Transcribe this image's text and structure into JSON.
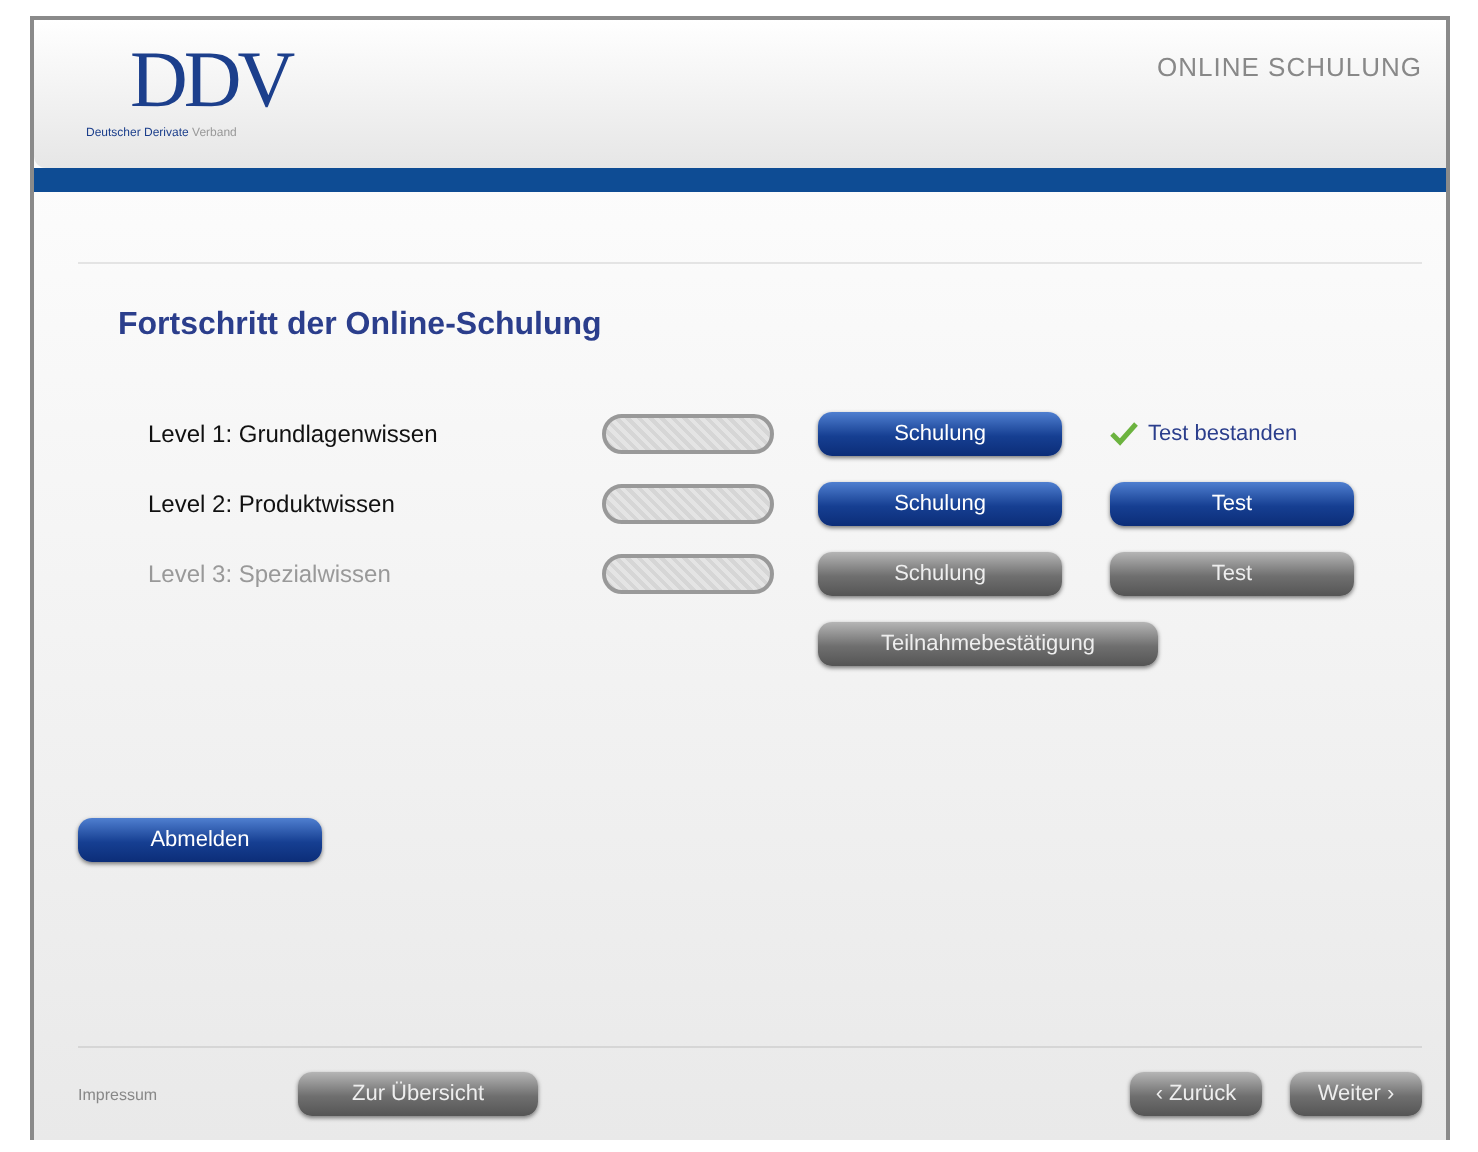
{
  "header": {
    "logo": {
      "mark": "DDV",
      "subtitle": "**Deutscher Derivate** Verband"
    },
    "title": "ONLINE SCHULUNG"
  },
  "heading": "Fortschritt der Online-Schulung",
  "levels": [
    {
      "label": "Level 1: Grundlagenwissen",
      "disabled": false,
      "level": 0,
      "training": {
        "label": "Schulung",
        "disabled": false
      },
      "test": {
        "kind": "status",
        "label": "Test bestanden"
      }
    },
    {
      "label": "Level 2: Produktwissen",
      "disabled": false,
      "level": 0,
      "training": {
        "label": "Schulung",
        "disabled": false
      },
      "test": {
        "kind": "button",
        "label": "Test",
        "disabled": false
      }
    },
    {
      "label": "Level 3: Spezialwissen",
      "disabled": true,
      "level": 0,
      "training": {
        "label": "Schulung",
        "disabled": true
      },
      "test": {
        "kind": "button",
        "label": "Test",
        "disabled": true
      }
    }
  ],
  "certificate": {
    "label": "Teilnahmebestätigung",
    "disabled": true
  },
  "logout": {
    "label": "Abmelden",
    "disabled": false
  },
  "footer": {
    "imprint": "Impressum",
    "overview": {
      "label": "Zur Übersicht",
      "disabled": true
    },
    "back": {
      "label": "‹ Zurück",
      "disabled": true
    },
    "next": {
      "label": "Weiter ›",
      "disabled": true
    }
  }
}
